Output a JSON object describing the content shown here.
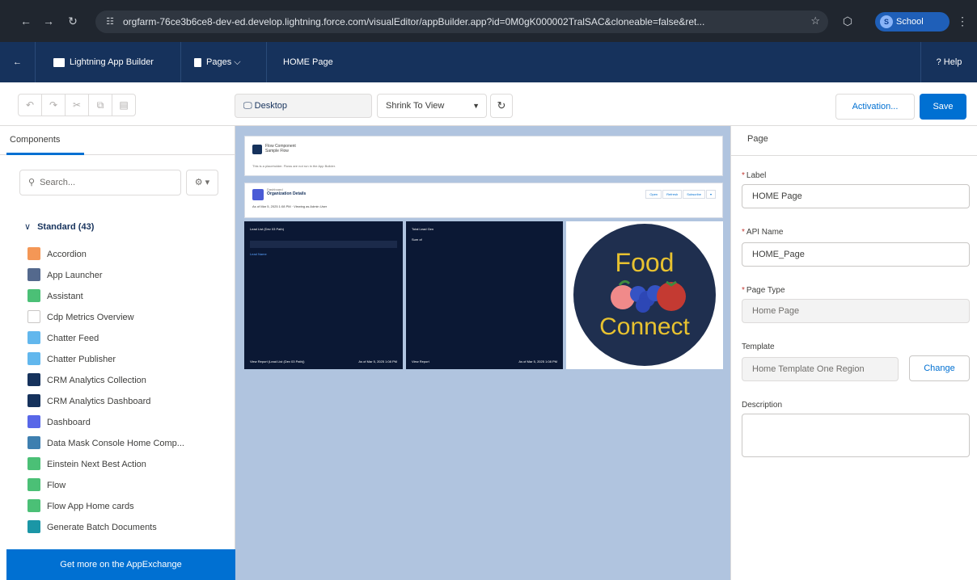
{
  "browser": {
    "url": "orgfarm-76ce3b6ce8-dev-ed.develop.lightning.force.com/visualEditor/appBuilder.app?id=0M0gK000002TralSAC&cloneable=false&ret...",
    "profile_label": "School",
    "profile_initial": "S"
  },
  "header": {
    "back_icon": "back-arrow-icon",
    "app_name": "Lightning App Builder",
    "pages_menu": "Pages ⌵",
    "page_name": "HOME Page",
    "help": "? Help"
  },
  "toolbar": {
    "device": "Desktop",
    "zoom": "Shrink To View",
    "activation": "Activation...",
    "save": "Save"
  },
  "left": {
    "tab": "Components",
    "search_placeholder": "Search...",
    "gear": "⚙ ▾",
    "section": "Standard (43)",
    "items": [
      {
        "label": "Accordion",
        "color": "#f49756"
      },
      {
        "label": "App Launcher",
        "color": "#54698d"
      },
      {
        "label": "Assistant",
        "color": "#4bc076"
      },
      {
        "label": "Cdp Metrics Overview",
        "color": "#ffffff"
      },
      {
        "label": "Chatter Feed",
        "color": "#62b7ed"
      },
      {
        "label": "Chatter Publisher",
        "color": "#62b7ed"
      },
      {
        "label": "CRM Analytics Collection",
        "color": "#16325c"
      },
      {
        "label": "CRM Analytics Dashboard",
        "color": "#16325c"
      },
      {
        "label": "Dashboard",
        "color": "#5867e8"
      },
      {
        "label": "Data Mask Console Home Comp...",
        "color": "#3e7fb0"
      },
      {
        "label": "Einstein Next Best Action",
        "color": "#4bc076"
      },
      {
        "label": "Flow",
        "color": "#4bc076"
      },
      {
        "label": "Flow App Home cards",
        "color": "#4bc076"
      },
      {
        "label": "Generate Batch Documents",
        "color": "#1b96a6"
      }
    ],
    "appexchange": "Get more on the AppExchange"
  },
  "canvas": {
    "card1_title": "Flow Component",
    "card1_sub": "Sample Flow",
    "card1_text": "This is a placeholder. Flows are not run in the App Builder.",
    "card2_sub": "Dashboard",
    "card2_title": "Organization Details",
    "card2_line": "As of Mar 5, 2025 1:08 PM · Viewing as Admin User",
    "card2_btns": [
      "Open",
      "Refresh",
      "Subscribe",
      "▾"
    ],
    "panel1_title": "Lead List (Dev 03 Path)",
    "panel1_row": "Lead Name",
    "panel1_footer": "View Report (Lead List (Dev 03 Path))",
    "panel1_date": "As of Mar 5, 2025 1:08 PM",
    "panel2_title": "Total Lead Gen",
    "panel2_sub": "Sum of",
    "panel2_footer": "View Report",
    "panel2_date": "As of Mar 5, 2025 1:08 PM",
    "logo_line1": "Food",
    "logo_line2": "Connect"
  },
  "right": {
    "title": "Page",
    "label_label": "Label",
    "label_value": "HOME Page",
    "api_label": "API Name",
    "api_value": "HOME_Page",
    "type_label": "Page Type",
    "type_value": "Home Page",
    "template_label": "Template",
    "template_value": "Home Template One Region",
    "change": "Change",
    "description_label": "Description"
  }
}
